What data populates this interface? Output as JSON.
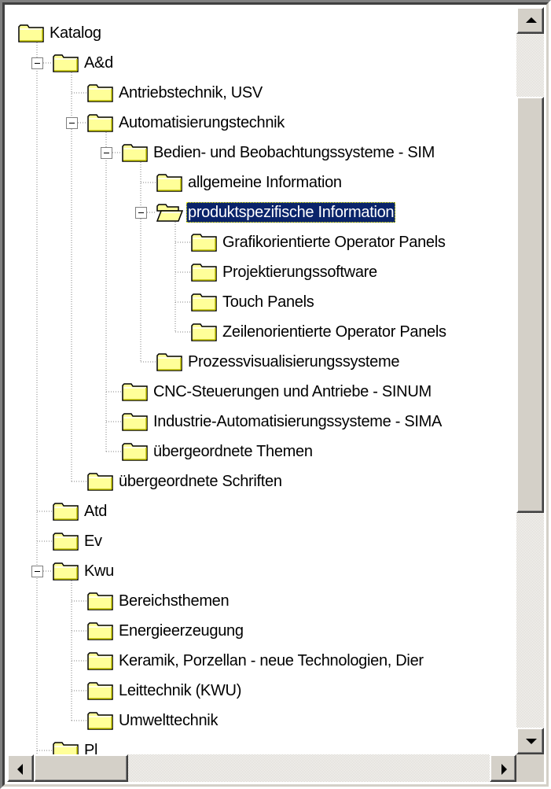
{
  "tree": {
    "nodes": [
      {
        "label": "Katalog",
        "depth": 0,
        "expander": "none"
      },
      {
        "label": "A&d",
        "depth": 1,
        "expander": "minus"
      },
      {
        "label": "Antriebstechnik, USV",
        "depth": 2,
        "expander": "none"
      },
      {
        "label": "Automatisierungstechnik",
        "depth": 2,
        "expander": "minus"
      },
      {
        "label": "Bedien- und Beobachtungssysteme - SIM",
        "depth": 3,
        "expander": "minus"
      },
      {
        "label": "allgemeine Information",
        "depth": 4,
        "expander": "none"
      },
      {
        "label": "produktspezifische Information",
        "depth": 4,
        "expander": "minus",
        "selected": true
      },
      {
        "label": "Grafikorientierte Operator Panels",
        "depth": 5,
        "expander": "none"
      },
      {
        "label": "Projektierungssoftware",
        "depth": 5,
        "expander": "none"
      },
      {
        "label": "Touch Panels",
        "depth": 5,
        "expander": "none"
      },
      {
        "label": "Zeilenorientierte Operator Panels",
        "depth": 5,
        "expander": "none"
      },
      {
        "label": "Prozessvisualisierungssysteme",
        "depth": 4,
        "expander": "none"
      },
      {
        "label": "CNC-Steuerungen und Antriebe - SINUM",
        "depth": 3,
        "expander": "none"
      },
      {
        "label": "Industrie-Automatisierungssysteme - SIMA",
        "depth": 3,
        "expander": "none"
      },
      {
        "label": "übergeordnete Themen",
        "depth": 3,
        "expander": "none"
      },
      {
        "label": "übergeordnete Schriften",
        "depth": 2,
        "expander": "none"
      },
      {
        "label": "Atd",
        "depth": 1,
        "expander": "none"
      },
      {
        "label": "Ev",
        "depth": 1,
        "expander": "none"
      },
      {
        "label": "Kwu",
        "depth": 1,
        "expander": "minus"
      },
      {
        "label": "Bereichsthemen",
        "depth": 2,
        "expander": "none"
      },
      {
        "label": "Energieerzeugung",
        "depth": 2,
        "expander": "none"
      },
      {
        "label": "Keramik, Porzellan - neue Technologien, Dier",
        "depth": 2,
        "expander": "none"
      },
      {
        "label": "Leittechnik (KWU)",
        "depth": 2,
        "expander": "none"
      },
      {
        "label": "Umwelttechnik",
        "depth": 2,
        "expander": "none"
      },
      {
        "label": "Pl",
        "depth": 1,
        "expander": "none"
      }
    ]
  },
  "icons": {
    "folder": "folder-icon",
    "folder_open": "folder-open-icon",
    "collapse": "collapse-minus-icon",
    "scroll_up": "arrow-up-icon",
    "scroll_down": "arrow-down-icon",
    "scroll_left": "arrow-left-icon",
    "scroll_right": "arrow-right-icon"
  },
  "colors": {
    "selection_bg": "#0a246a",
    "selection_text": "#ffffff",
    "folder_fill": "#ffff99",
    "folder_shade": "#c0c000",
    "chrome": "#d4d0c8"
  },
  "scroll": {
    "vertical_thumb_fraction": 0.6,
    "vertical_position_fraction": 0.0,
    "horizontal_thumb_fraction": 0.12,
    "horizontal_position_fraction": 0.0
  }
}
